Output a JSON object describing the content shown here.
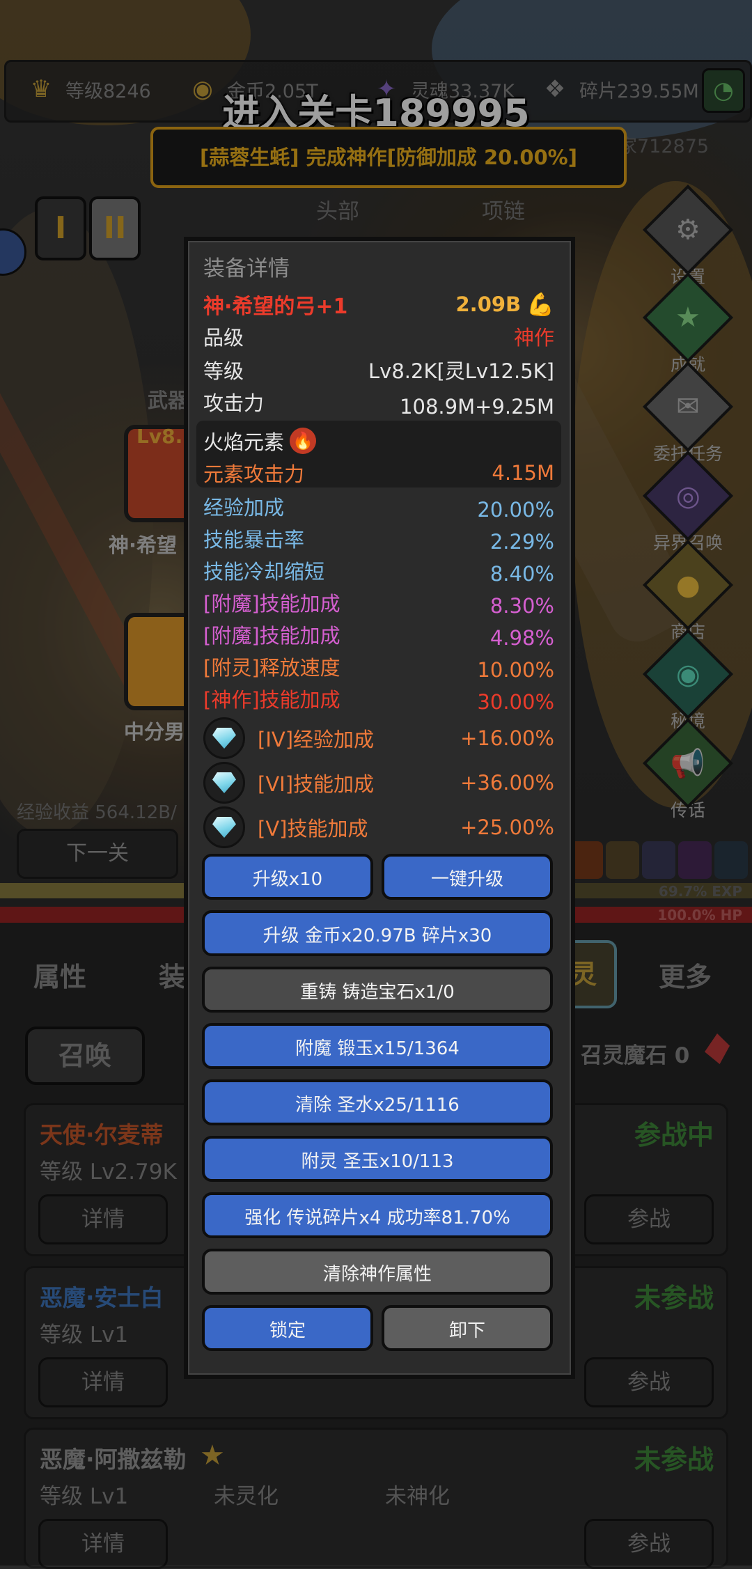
{
  "topbar": {
    "level": "等级8246",
    "gold": "金币2.05T",
    "soul": "灵魂33.37K",
    "shards": "碎片239.55M"
  },
  "stage_title": "进入关卡189995",
  "banner": {
    "text": "[蒜蓉生蚝] 完成神作[防御加成 20.00%]",
    "right_text": "家712875"
  },
  "page_tabs": [
    "I",
    "II"
  ],
  "slot_tabs": [
    "头部",
    "项链"
  ],
  "side_menu": [
    "设置",
    "成就",
    "委托任务",
    "异界召唤",
    "商店",
    "秘境",
    "传话"
  ],
  "left_labels": {
    "weapon_tag": "武器",
    "weapon_lv": "Lv8.",
    "weapon_name": "神·希望",
    "center_name": "中分男",
    "exp_text": "经验收益 564.12B/",
    "next_stage": "下一关"
  },
  "bars": {
    "exp_label": "69.7% EXP",
    "exp_fraction": 0.697,
    "hp_label": "100.0% HP",
    "hp_fraction": 1.0
  },
  "panel": {
    "title": "装备详情",
    "item_name": "神·希望的弓+1",
    "item_power": "2.09B",
    "grade_label": "品级",
    "grade_value": "神作",
    "level_label": "等级",
    "level_value": "Lv8.2K[灵Lv12.5K]",
    "attack_label": "攻击力",
    "attack_value": "108.9M+9.25M",
    "element_label": "火焰元素",
    "element_attack_label": "元素攻击力",
    "element_attack_value": "4.15M",
    "stats": [
      {
        "label": "经验加成",
        "value": "20.00%",
        "color": "#79b9e6"
      },
      {
        "label": "技能暴击率",
        "value": "2.29%",
        "color": "#79b9e6"
      },
      {
        "label": "技能冷却缩短",
        "value": "8.40%",
        "color": "#79b9e6"
      },
      {
        "label": "[附魔]技能加成",
        "value": "8.30%",
        "color": "#d55fd0"
      },
      {
        "label": "[附魔]技能加成",
        "value": "4.98%",
        "color": "#d55fd0"
      },
      {
        "label": "[附灵]释放速度",
        "value": "10.00%",
        "color": "#f07a3a"
      },
      {
        "label": "[神作]技能加成",
        "value": "30.00%",
        "color": "#ec3b2b"
      }
    ],
    "gems": [
      {
        "label": "[IV]经验加成",
        "value": "+16.00%",
        "icon": "diamond-icon"
      },
      {
        "label": "[VI]技能加成",
        "value": "+36.00%",
        "icon": "diamond-icon"
      },
      {
        "label": "[V]技能加成",
        "value": "+25.00%",
        "icon": "diamond-icon"
      }
    ],
    "buttons": {
      "upgrade10": "升级x10",
      "one_key_upgrade": "一键升级",
      "upgrade_cost": "升级 金币x20.97B 碎片x30",
      "reforge": "重铸 铸造宝石x1/0",
      "enchant": "附魔 锻玉x15/1364",
      "clear": "清除 圣水x25/1116",
      "spirit": "附灵 圣玉x10/113",
      "strengthen": "强化 传说碎片x4 成功率81.70%",
      "clear_divine": "清除神作属性",
      "lock": "锁定",
      "unequip": "卸下"
    }
  },
  "bottom_tabs": {
    "attr": "属性",
    "equip": "装",
    "spirit": "灵",
    "more": "更多"
  },
  "summon": {
    "button": "召唤",
    "stone": "召灵魔石 0"
  },
  "spirits": [
    {
      "name": "天使·尔麦蒂",
      "level": "等级 Lv2.79K",
      "status": "参战中",
      "detail": "详情",
      "battle": "参战",
      "name_color": "#c9582a"
    },
    {
      "name": "恶魔·安士白",
      "level": "等级 Lv1",
      "status": "未参战",
      "detail": "详情",
      "battle": "参战",
      "name_color": "#3f78c0"
    },
    {
      "name": "恶魔·阿撒兹勒",
      "level": "等级 Lv1",
      "status": "未参战",
      "detail": "详情",
      "battle": "参战",
      "name_color": "#9a9a9a",
      "spirit_state": "未灵化",
      "divine_state": "未神化"
    }
  ],
  "colors": {
    "accent_gold": "#e1a21a",
    "button_blue": "#3a68c7",
    "element_red": "#ec3b2b"
  }
}
